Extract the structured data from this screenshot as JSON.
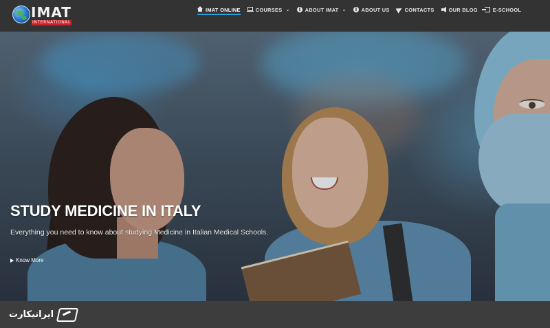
{
  "logo": {
    "text": "IMAT",
    "subtext": "INTERNATIONAL"
  },
  "nav": {
    "items": [
      {
        "label": "IMAT ONLINE",
        "icon": "home-icon",
        "active": true,
        "dropdown": false
      },
      {
        "label": "COURSES",
        "icon": "laptop-icon",
        "active": false,
        "dropdown": true
      },
      {
        "label": "ABOUT IMAT",
        "icon": "info-icon",
        "active": false,
        "dropdown": true
      },
      {
        "label": "ABOUT US",
        "icon": "info-icon",
        "active": false,
        "dropdown": false
      },
      {
        "label": "CONTACTS",
        "icon": "paper-plane-icon",
        "active": false,
        "dropdown": false
      },
      {
        "label": "OUR BLOG",
        "icon": "bullhorn-icon",
        "active": false,
        "dropdown": false
      },
      {
        "label": "E-SCHOOL",
        "icon": "sign-in-icon",
        "active": false,
        "dropdown": false
      }
    ],
    "accent_color": "#2aa4e0"
  },
  "hero": {
    "title": "STUDY MEDICINE IN ITALY",
    "subtitle": "Everything you need to know about studying Medicine in Italian Medical Schools.",
    "button_label": "Know More"
  },
  "watermark": {
    "text": "ایرانیکارت"
  },
  "colors": {
    "navbar": "#333333",
    "bottom": "#3d3d3d",
    "logo_red": "#c8232c"
  }
}
